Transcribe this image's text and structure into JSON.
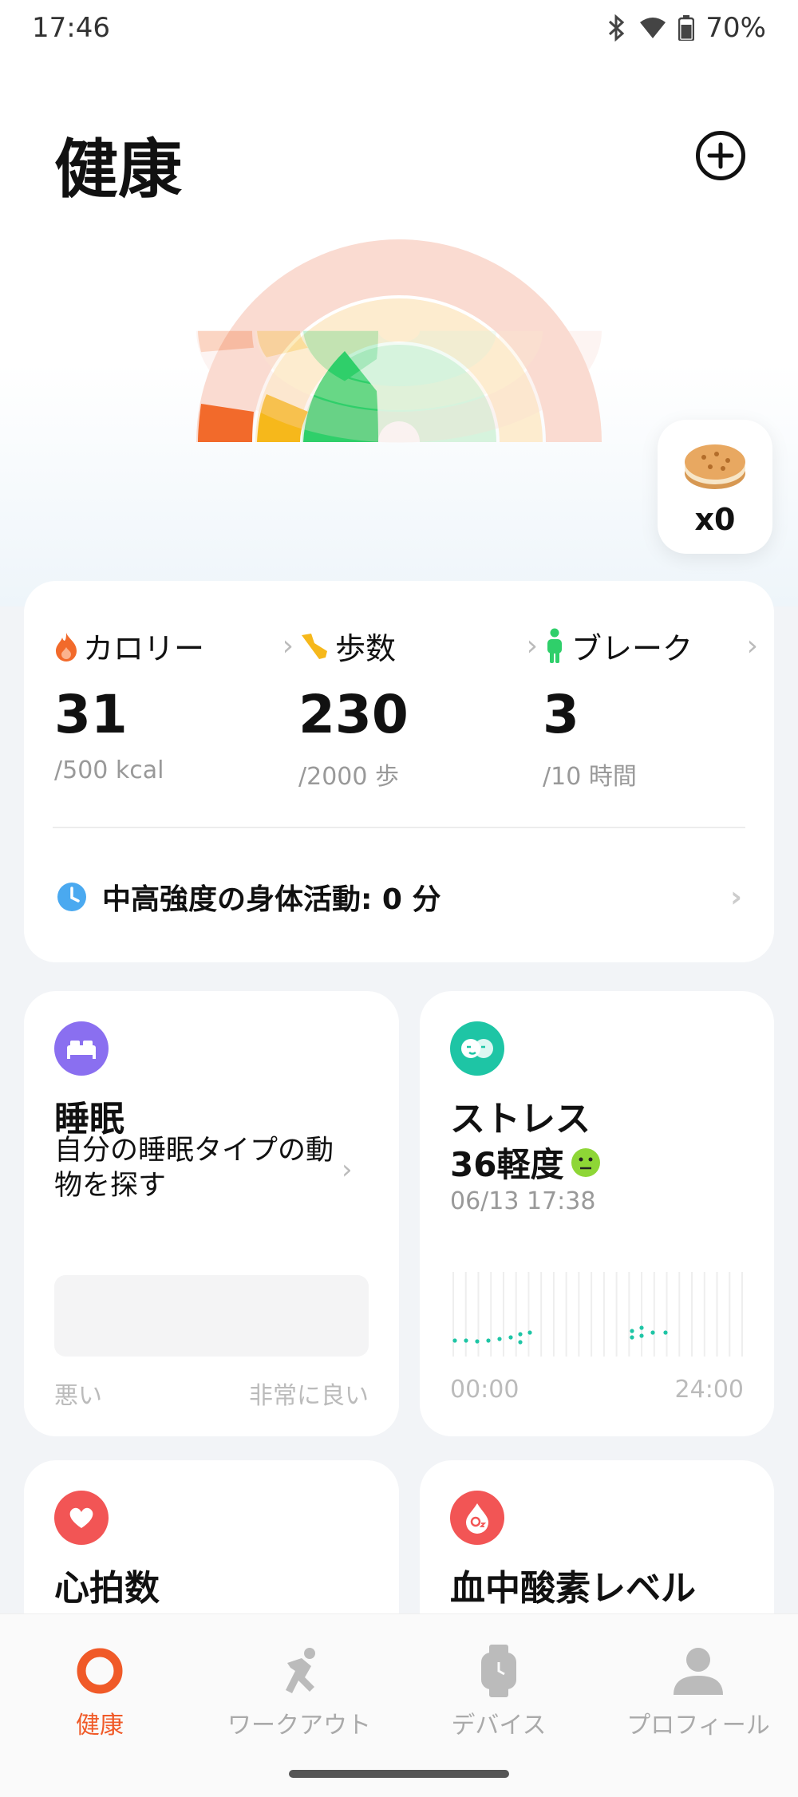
{
  "status_bar": {
    "time": "17:46",
    "battery": "70%"
  },
  "header": {
    "title": "健康"
  },
  "badge": {
    "count": "x0"
  },
  "activity": {
    "calorie": {
      "label": "カロリー",
      "value": "31",
      "goal": "/500 kcal"
    },
    "steps": {
      "label": "歩数",
      "value": "230",
      "goal": "/2000 歩"
    },
    "break": {
      "label": "ブレーク",
      "value": "3",
      "goal": "/10 時間"
    },
    "mvpa_label": "中高強度の身体活動: 0 分"
  },
  "sleep": {
    "title": "睡眠",
    "subtitle": "自分の睡眠タイプの動物を探す",
    "scale_low": "悪い",
    "scale_high": "非常に良い"
  },
  "stress": {
    "title": "ストレス",
    "value": "36軽度",
    "timestamp": "06/13 17:38",
    "axis_start": "00:00",
    "axis_end": "24:00"
  },
  "heart": {
    "title": "心拍数"
  },
  "spo2": {
    "title": "血中酸素レベル"
  },
  "tabs": [
    {
      "label": "健康"
    },
    {
      "label": "ワークアウト"
    },
    {
      "label": "デバイス"
    },
    {
      "label": "プロフィール"
    }
  ],
  "colors": {
    "accent": "#f05a28",
    "calorie": "#f26a2b",
    "steps": "#f6b81b",
    "break": "#2fcf6a",
    "sleep_icon": "#8a6ff0",
    "stress_icon": "#1ec5a5",
    "heart_icon": "#f25555"
  }
}
